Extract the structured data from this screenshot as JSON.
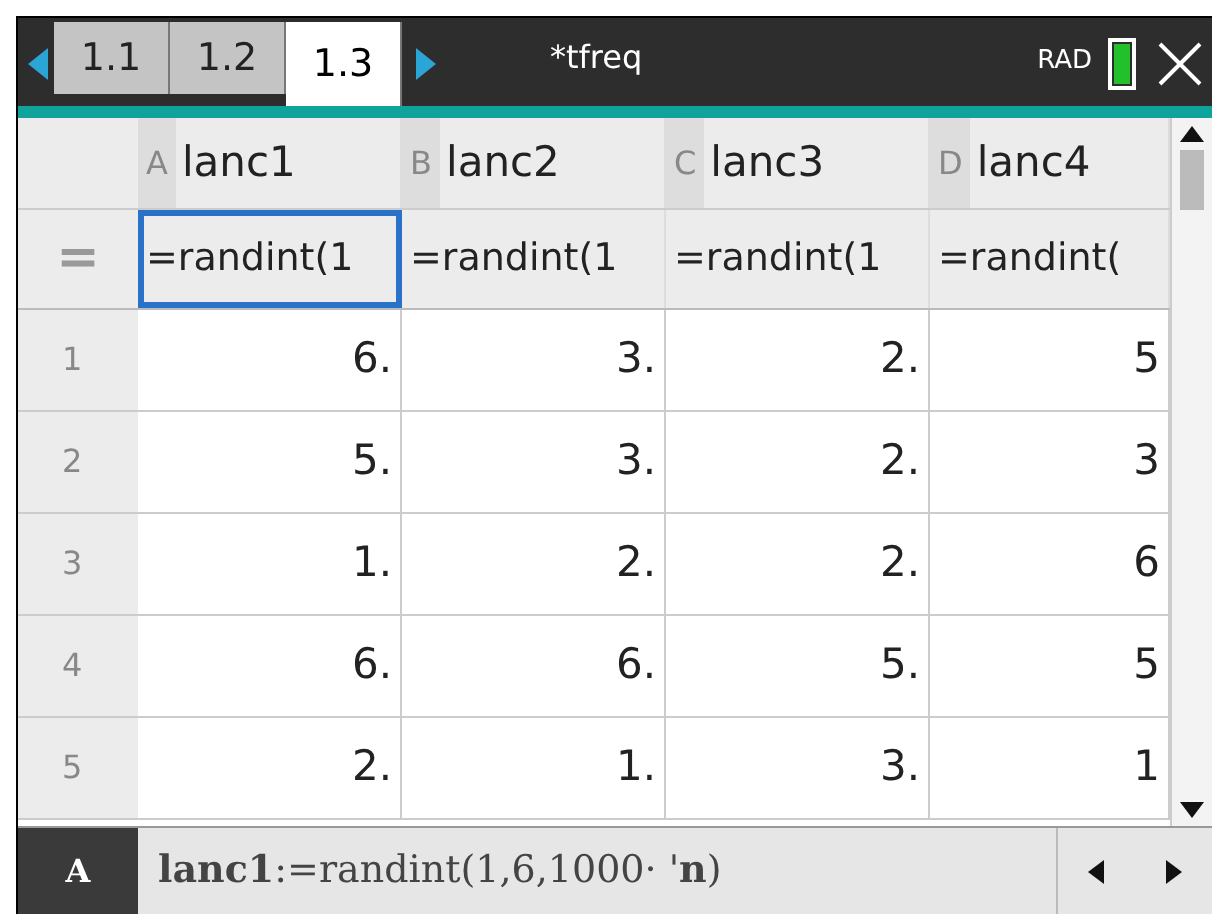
{
  "tabs": [
    {
      "label": "1.1",
      "selected": false
    },
    {
      "label": "1.2",
      "selected": false
    },
    {
      "label": "1.3",
      "selected": true
    }
  ],
  "document_title": "*tfreq",
  "angle_mode": "RAD",
  "table": {
    "columns": [
      {
        "letter": "A",
        "name": "lanc1",
        "formula": "=randint(1",
        "selected": true
      },
      {
        "letter": "B",
        "name": "lanc2",
        "formula": "=randint(1",
        "selected": false
      },
      {
        "letter": "C",
        "name": "lanc3",
        "formula": "=randint(1",
        "selected": false
      },
      {
        "letter": "D",
        "name": "lanc4",
        "formula": "=randint(",
        "selected": false
      }
    ],
    "formula_row_label": "=",
    "rows": [
      {
        "number": "1",
        "cells": [
          "6.",
          "3.",
          "2.",
          "5"
        ]
      },
      {
        "number": "2",
        "cells": [
          "5.",
          "3.",
          "2.",
          "3"
        ]
      },
      {
        "number": "3",
        "cells": [
          "1.",
          "2.",
          "2.",
          "6"
        ]
      },
      {
        "number": "4",
        "cells": [
          "6.",
          "6.",
          "5.",
          "5"
        ]
      },
      {
        "number": "5",
        "cells": [
          "2.",
          "1.",
          "3.",
          "1"
        ]
      }
    ]
  },
  "entry_line": {
    "cell": "A",
    "expression": "**lanc1**:=randint(1,6,1000· '**n**)"
  }
}
